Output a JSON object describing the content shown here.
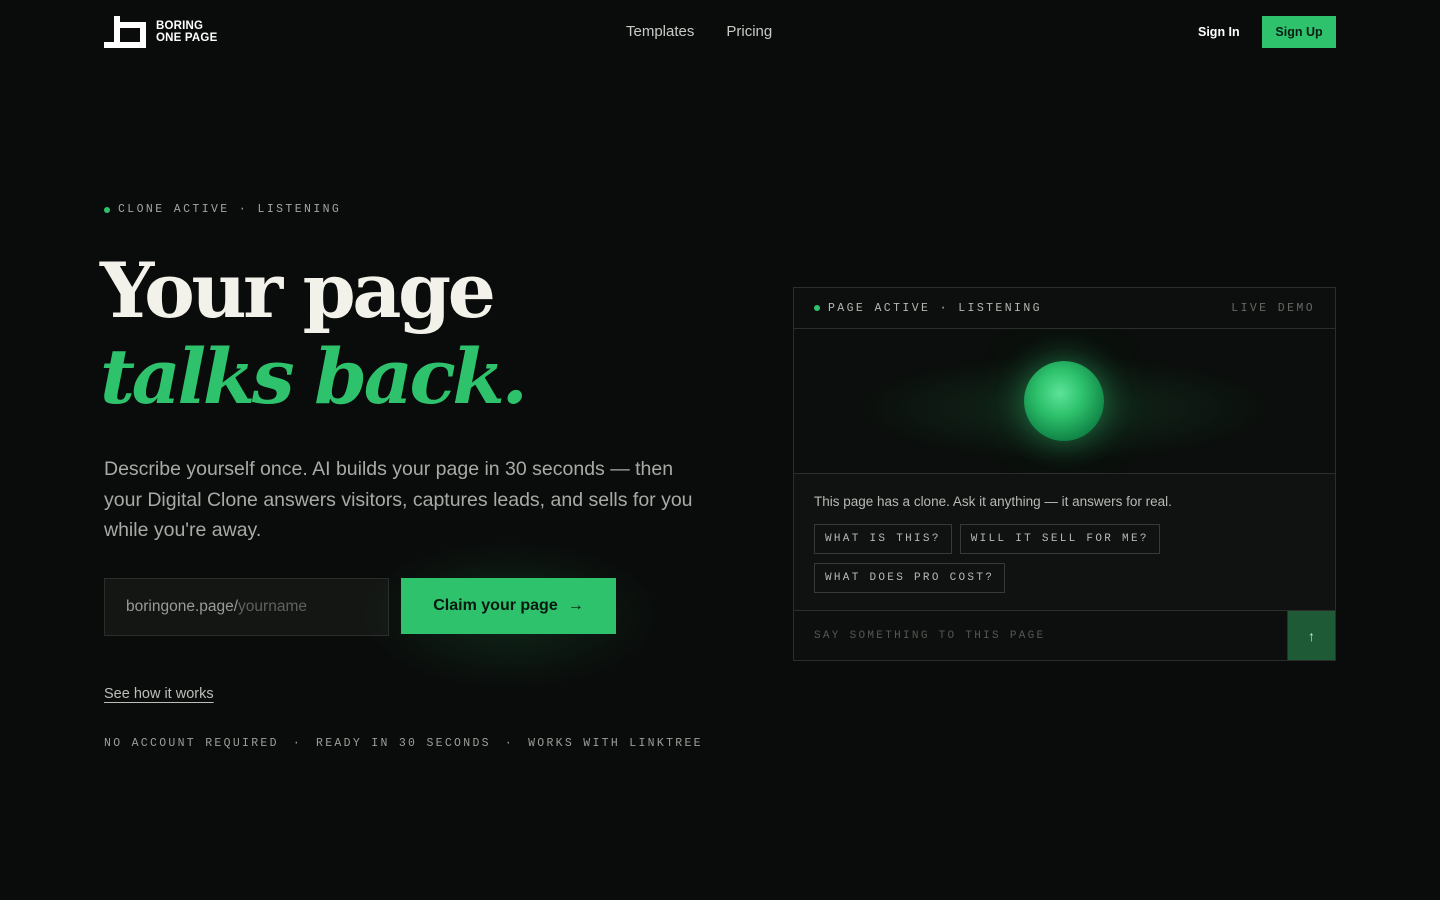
{
  "header": {
    "logo_line1": "BORING",
    "logo_line2": "ONE PAGE",
    "nav": [
      "Templates",
      "Pricing"
    ],
    "sign_in": "Sign In",
    "sign_up": "Sign Up"
  },
  "hero": {
    "status": "CLONE ACTIVE · LISTENING",
    "headline_line1": "Your page",
    "headline_line2": "talks back.",
    "description": "Describe yourself once. AI builds your page in 30 seconds — then your Digital Clone answers visitors, captures leads, and sells for you while you're away.",
    "url_prefix": "boringone.page/",
    "url_placeholder": "yourname",
    "cta_label": "Claim your page",
    "cta_icon": "arrow-right-icon",
    "how_link": "See how it works",
    "features": [
      "NO ACCOUNT REQUIRED",
      "·",
      "READY IN 30 SECONDS",
      "·",
      "WORKS WITH LINKTREE"
    ]
  },
  "demo": {
    "status": "PAGE ACTIVE · LISTENING",
    "badge": "LIVE DEMO",
    "intro": "This page has a clone. Ask it anything — it answers for real.",
    "chips": [
      "WHAT IS THIS?",
      "WILL IT SELL FOR ME?",
      "WHAT DOES PRO COST?"
    ],
    "input_placeholder": "SAY SOMETHING TO THIS PAGE",
    "send_icon": "arrow-up-icon"
  },
  "colors": {
    "background": "#0a0c0b",
    "accent": "#2ec26c",
    "text": "#f2f1ea"
  }
}
